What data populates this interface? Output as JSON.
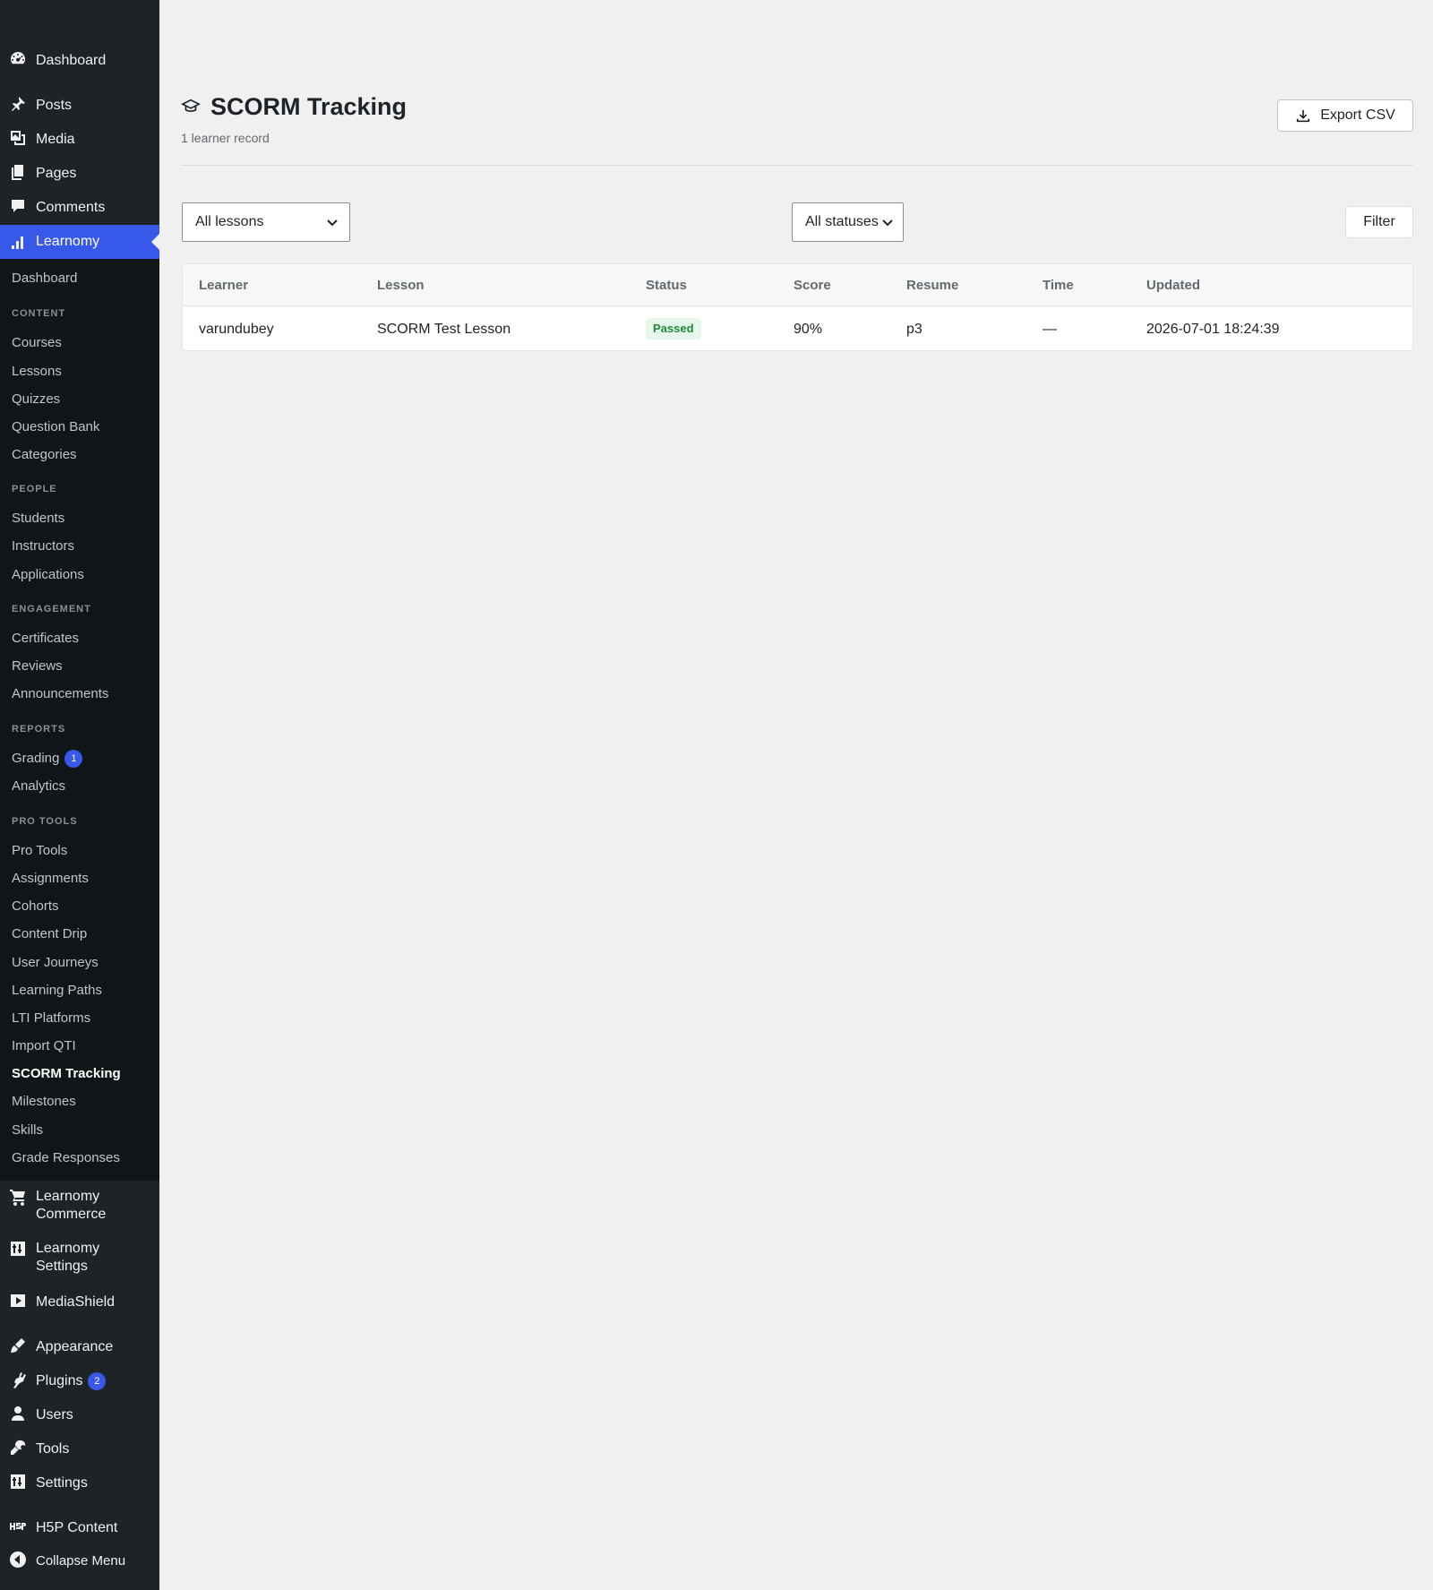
{
  "sidebar": {
    "top_items": [
      {
        "id": "dashboard",
        "label": "Dashboard",
        "icon": "dashboard-icon"
      },
      {
        "id": "posts",
        "label": "Posts",
        "icon": "pin-icon"
      },
      {
        "id": "media",
        "label": "Media",
        "icon": "media-icon"
      },
      {
        "id": "pages",
        "label": "Pages",
        "icon": "pages-icon"
      },
      {
        "id": "comments",
        "label": "Comments",
        "icon": "comment-icon"
      },
      {
        "id": "learnomy",
        "label": "Learnomy",
        "icon": "chart-icon"
      }
    ],
    "submenu": {
      "dashboard": "Dashboard",
      "content_head": "CONTENT",
      "courses": "Courses",
      "lessons": "Lessons",
      "quizzes": "Quizzes",
      "question_bank": "Question Bank",
      "categories": "Categories",
      "people_head": "PEOPLE",
      "students": "Students",
      "instructors": "Instructors",
      "applications": "Applications",
      "engagement_head": "ENGAGEMENT",
      "certificates": "Certificates",
      "reviews": "Reviews",
      "announcements": "Announcements",
      "reports_head": "REPORTS",
      "grading": "Grading",
      "grading_badge": "1",
      "analytics": "Analytics",
      "pro_tools_head": "PRO TOOLS",
      "pro_tools": "Pro Tools",
      "assignments": "Assignments",
      "cohorts": "Cohorts",
      "content_drip": "Content Drip",
      "user_journeys": "User Journeys",
      "learning_paths": "Learning Paths",
      "lti_platforms": "LTI Platforms",
      "import_qti": "Import QTI",
      "scorm_tracking": "SCORM Tracking",
      "milestones": "Milestones",
      "skills": "Skills",
      "grade_responses": "Grade Responses"
    },
    "bottom_items": {
      "commerce_1": "Learnomy",
      "commerce_2": "Commerce",
      "settings_1": "Learnomy",
      "settings_2": "Settings",
      "mediashield": "MediaShield",
      "appearance": "Appearance",
      "plugins": "Plugins",
      "plugins_badge": "2",
      "users": "Users",
      "tools": "Tools",
      "settings": "Settings",
      "h5p": "H5P Content",
      "collapse": "Collapse Menu"
    }
  },
  "header": {
    "title": "SCORM Tracking",
    "subtitle": "1 learner record",
    "export_label": "Export CSV",
    "title_icon": "graduation-cap-icon"
  },
  "filters": {
    "lesson_selected": "All lessons",
    "status_selected": "All statuses",
    "filter_label": "Filter"
  },
  "table": {
    "columns": [
      "Learner",
      "Lesson",
      "Status",
      "Score",
      "Resume",
      "Time",
      "Updated"
    ],
    "rows": [
      {
        "learner": "varundubey",
        "lesson": "SCORM Test Lesson",
        "status": "Passed",
        "score": "90%",
        "resume": "p3",
        "time": "—",
        "updated": "2026-07-01 18:24:39"
      }
    ]
  },
  "colors": {
    "sidebar_bg": "#1d2327",
    "submenu_bg": "#101517",
    "accent": "#3858e9",
    "passed_bg": "#e6f6ea",
    "passed_text": "#1f8a3b"
  }
}
